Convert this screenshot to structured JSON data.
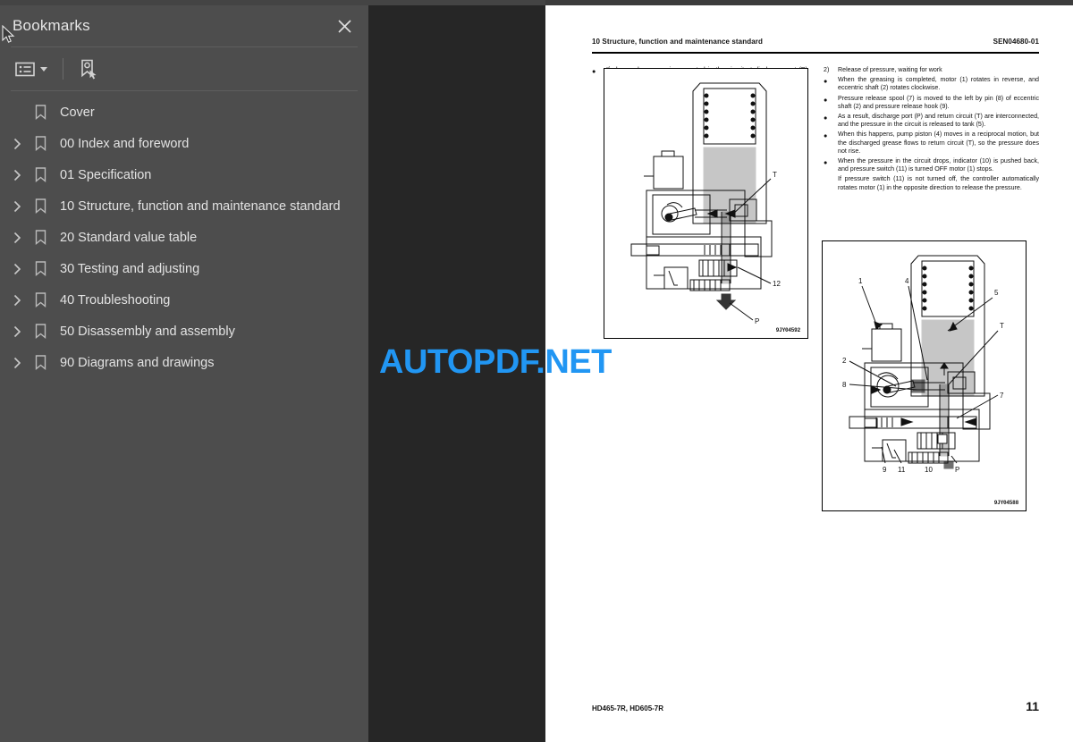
{
  "sidebar": {
    "title": "Bookmarks",
    "close_icon": "close-icon",
    "toolbar": {
      "options_icon": "list-options-icon",
      "caret_icon": "chevron-down-icon",
      "new_bookmark_icon": "new-bookmark-icon"
    },
    "items": [
      {
        "label": "Cover",
        "expandable": false
      },
      {
        "label": "00 Index and foreword",
        "expandable": true
      },
      {
        "label": "01 Specification",
        "expandable": true
      },
      {
        "label": "10 Structure, function and maintenance standard",
        "expandable": true
      },
      {
        "label": "20 Standard value table",
        "expandable": true
      },
      {
        "label": "30 Testing and adjusting",
        "expandable": true
      },
      {
        "label": "40 Troubleshooting",
        "expandable": true
      },
      {
        "label": "50 Disassembly and assembly",
        "expandable": true
      },
      {
        "label": "90 Diagrams and drawings",
        "expandable": true
      }
    ]
  },
  "watermark": {
    "text": "AUTOPDF.NET",
    "color": "#2196f3"
  },
  "document": {
    "header": {
      "left": "10 Structure, function and maintenance standard",
      "right": "SEN04680-01"
    },
    "footer": {
      "left": "HD465-7R, HD605-7R",
      "page_number": "11"
    },
    "left_column": {
      "paragraphs": [
        {
          "marker": "●",
          "text": "If abnormal pressure is generated in the circuit at discharge port (P) end, safety valve (12) opens and releases the pressure to return circuit (T) to protect the equipment from damage."
        }
      ],
      "figure": {
        "code": "9JY04592",
        "callouts": [
          "T",
          "12",
          "P"
        ]
      }
    },
    "right_column": {
      "paragraphs": [
        {
          "marker": "2)",
          "text": "Release of pressure, waiting for work"
        },
        {
          "marker": "●",
          "text": "When the greasing is completed, motor (1) rotates in reverse, and eccentric shaft (2) rotates clockwise."
        },
        {
          "marker": "●",
          "text": "Pressure release spool (7) is moved to the left by pin (8) of eccentric shaft (2) and pressure release hook (9)."
        },
        {
          "marker": "●",
          "text": "As a result, discharge port (P) and return circuit (T) are interconnected, and the pressure in the circuit is released to tank (5)."
        },
        {
          "marker": "●",
          "text": "When this happens, pump piston (4) moves in a reciprocal motion, but the discharged grease flows to return circuit (T), so the pressure does not rise."
        },
        {
          "marker": "●",
          "text": "When the pressure in the circuit drops, indicator (10) is pushed back, and pressure switch (11) is turned OFF motor (1) stops."
        },
        {
          "marker": "",
          "text": "If pressure switch (11) is not turned off, the controller automatically rotates motor (1) in the opposite direction to release the pressure."
        }
      ],
      "figure": {
        "code": "9JY04588",
        "callouts": [
          "1",
          "4",
          "5",
          "T",
          "2",
          "8",
          "7",
          "9",
          "11",
          "10",
          "P"
        ]
      }
    }
  }
}
